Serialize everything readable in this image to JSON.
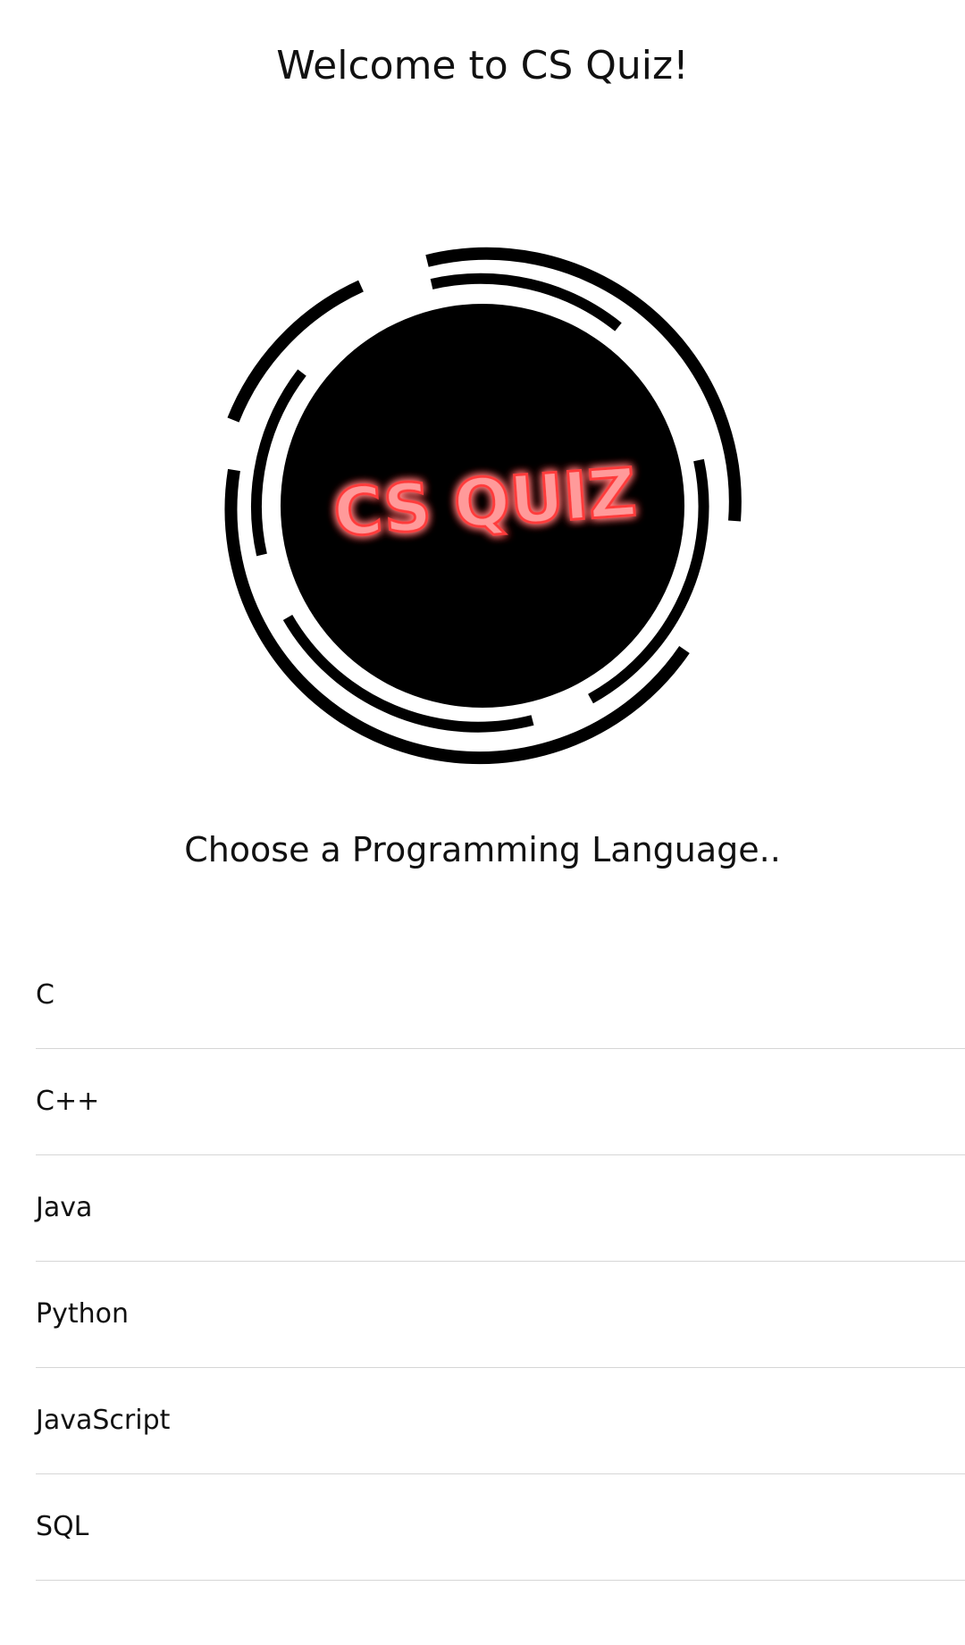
{
  "header": {
    "title": "Welcome to CS Quiz!"
  },
  "logo": {
    "text": "CS QUIZ",
    "glow_color": "#ff3b3b",
    "ring_color": "#000000"
  },
  "prompt": {
    "text": "Choose a Programming Language.."
  },
  "languages": [
    {
      "label": "C"
    },
    {
      "label": "C++"
    },
    {
      "label": "Java"
    },
    {
      "label": "Python"
    },
    {
      "label": "JavaScript"
    },
    {
      "label": "SQL"
    }
  ]
}
